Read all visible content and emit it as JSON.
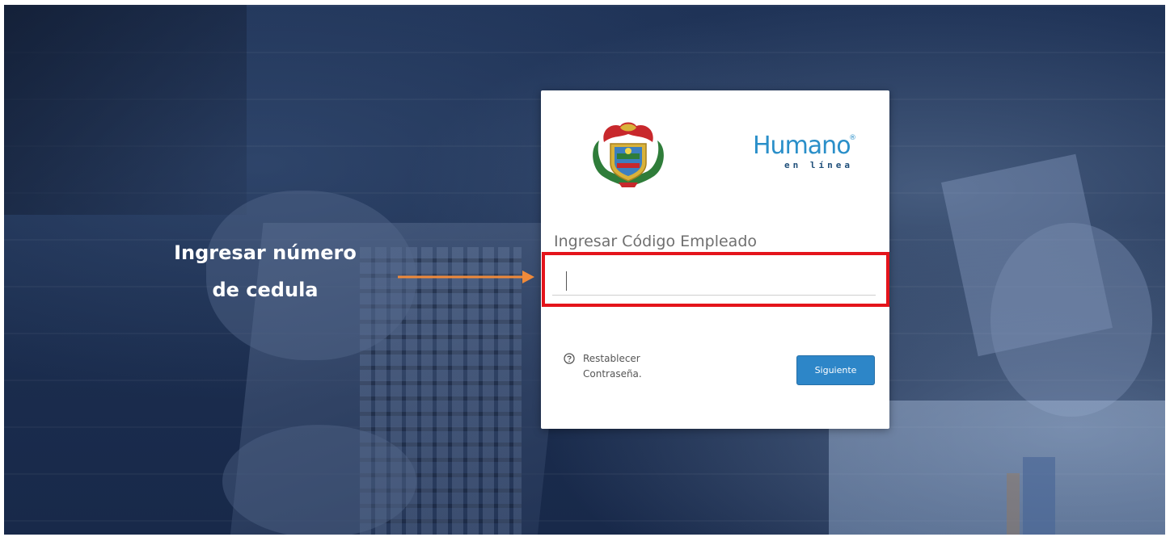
{
  "annotation": {
    "line1": "Ingresar número",
    "line2": "de cedula",
    "arrow_color": "#ef8a3a"
  },
  "login": {
    "logo_main": "Humano",
    "logo_registered": "®",
    "logo_sub": "en línea",
    "field_label": "Ingresar Código Empleado",
    "field_value": "",
    "reset_line1": "Restablecer",
    "reset_line2": "Contraseña.",
    "reset_icon": "question-circle-icon",
    "submit_label": "Siguiente"
  },
  "colors": {
    "brand_blue": "#2a8fc9",
    "button_blue": "#2d86c8",
    "highlight_red": "#e4141b",
    "background_navy": "#1f3357"
  }
}
